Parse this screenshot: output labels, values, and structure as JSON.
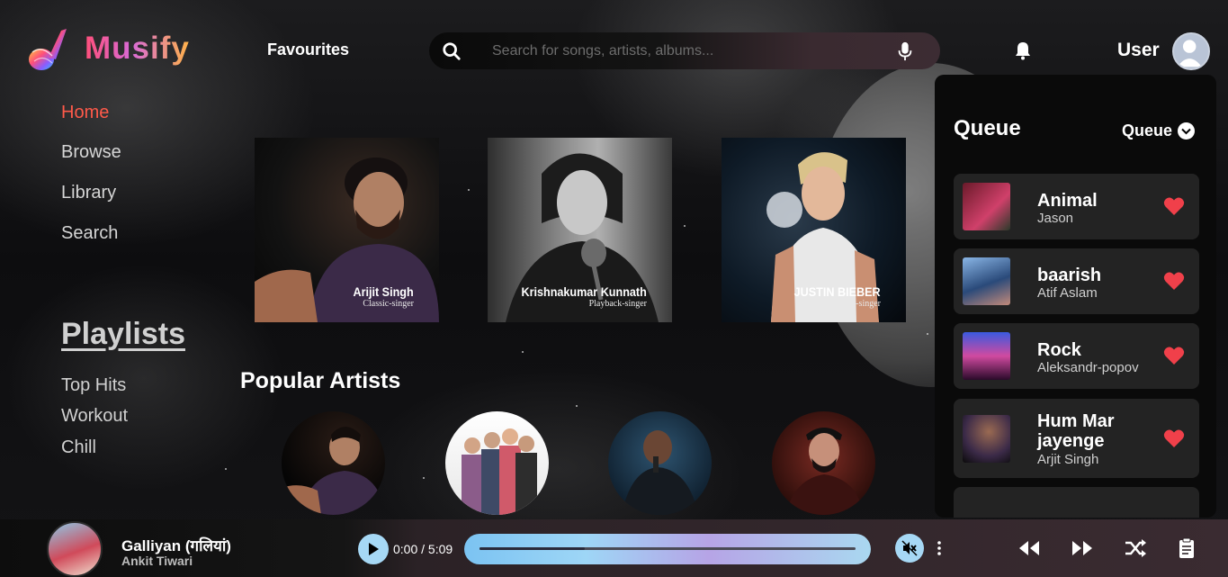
{
  "app": {
    "name": "Musify",
    "favourites_label": "Favourites",
    "user_label": "User"
  },
  "search": {
    "placeholder": "Search for songs, artists, albums...",
    "value": ""
  },
  "sidebar": {
    "nav": [
      {
        "label": "Home",
        "active": true
      },
      {
        "label": "Browse",
        "active": false
      },
      {
        "label": "Library",
        "active": false
      },
      {
        "label": "Search",
        "active": false
      }
    ],
    "playlists_title": "Playlists",
    "playlists": [
      "Top Hits",
      "Workout",
      "Chill"
    ]
  },
  "featured": [
    {
      "name": "Arijit Singh",
      "subtitle": "Classic-singer"
    },
    {
      "name": "Krishnakumar Kunnath",
      "subtitle": "Playback-singer"
    },
    {
      "name": "JUSTIN BIEBER",
      "subtitle": "Pop-singer"
    }
  ],
  "popular_artists_title": "Popular Artists",
  "queue": {
    "title": "Queue",
    "dropdown_label": "Queue",
    "items": [
      {
        "title": "Animal",
        "artist": "Jason",
        "liked": true
      },
      {
        "title": "baarish",
        "artist": "Atif Aslam",
        "liked": true
      },
      {
        "title": "Rock",
        "artist": "Aleksandr-popov",
        "liked": true
      },
      {
        "title": "Hum Mar jayenge",
        "artist": "Arjit Singh",
        "liked": true
      }
    ]
  },
  "player": {
    "track_title": "Galliyan (गलियां)",
    "track_artist": "Ankit Tiwari",
    "time": "0:00 / 5:09",
    "progress": 0.28
  },
  "colors": {
    "accent_active": "#ff5a4a",
    "heart": "#f0404a",
    "control_blue": "#a6d8f5"
  }
}
